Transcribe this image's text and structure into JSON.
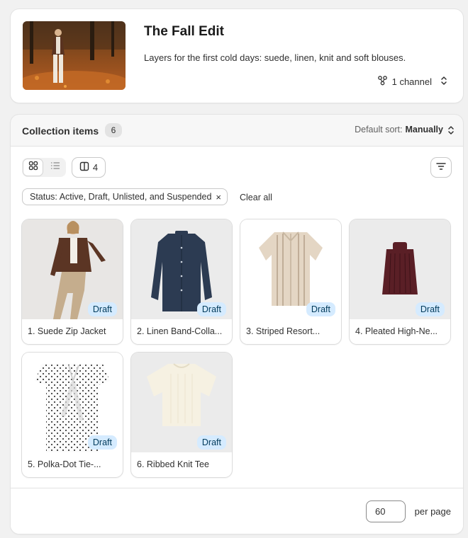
{
  "collection": {
    "title": "The Fall Edit",
    "description": "Layers for the first cold days: suede, linen, knit and soft blouses.",
    "channel_label": "1 channel"
  },
  "items_section": {
    "title": "Collection items",
    "count": "6",
    "sort_prefix": "Default sort:",
    "sort_value": "Manually"
  },
  "toolbar": {
    "columns_count": "4",
    "filter_chip": "Status: Active, Draft, Unlisted, and Suspended",
    "chip_remove": "×",
    "clear_all": "Clear all"
  },
  "products": [
    {
      "label": "1. Suede Zip Jacket",
      "status": "Draft",
      "image": "suede-jacket-model"
    },
    {
      "label": "2. Linen Band-Colla...",
      "status": "Draft",
      "image": "navy-linen-shirt"
    },
    {
      "label": "3. Striped Resort...",
      "status": "Draft",
      "image": "striped-resort-shirt"
    },
    {
      "label": "4. Pleated High-Ne...",
      "status": "Draft",
      "image": "burgundy-pleated-top"
    },
    {
      "label": "5. Polka-Dot Tie-...",
      "status": "Draft",
      "image": "polka-dot-blouse"
    },
    {
      "label": "6. Ribbed Knit Tee",
      "status": "Draft",
      "image": "cream-knit-tee"
    }
  ],
  "pagination": {
    "per_page_value": "60",
    "per_page_label": "per page"
  },
  "colors": {
    "draft_badge_bg": "#d5ebff",
    "draft_badge_text": "#003a5a",
    "page_bg": "#f1f1f1"
  }
}
